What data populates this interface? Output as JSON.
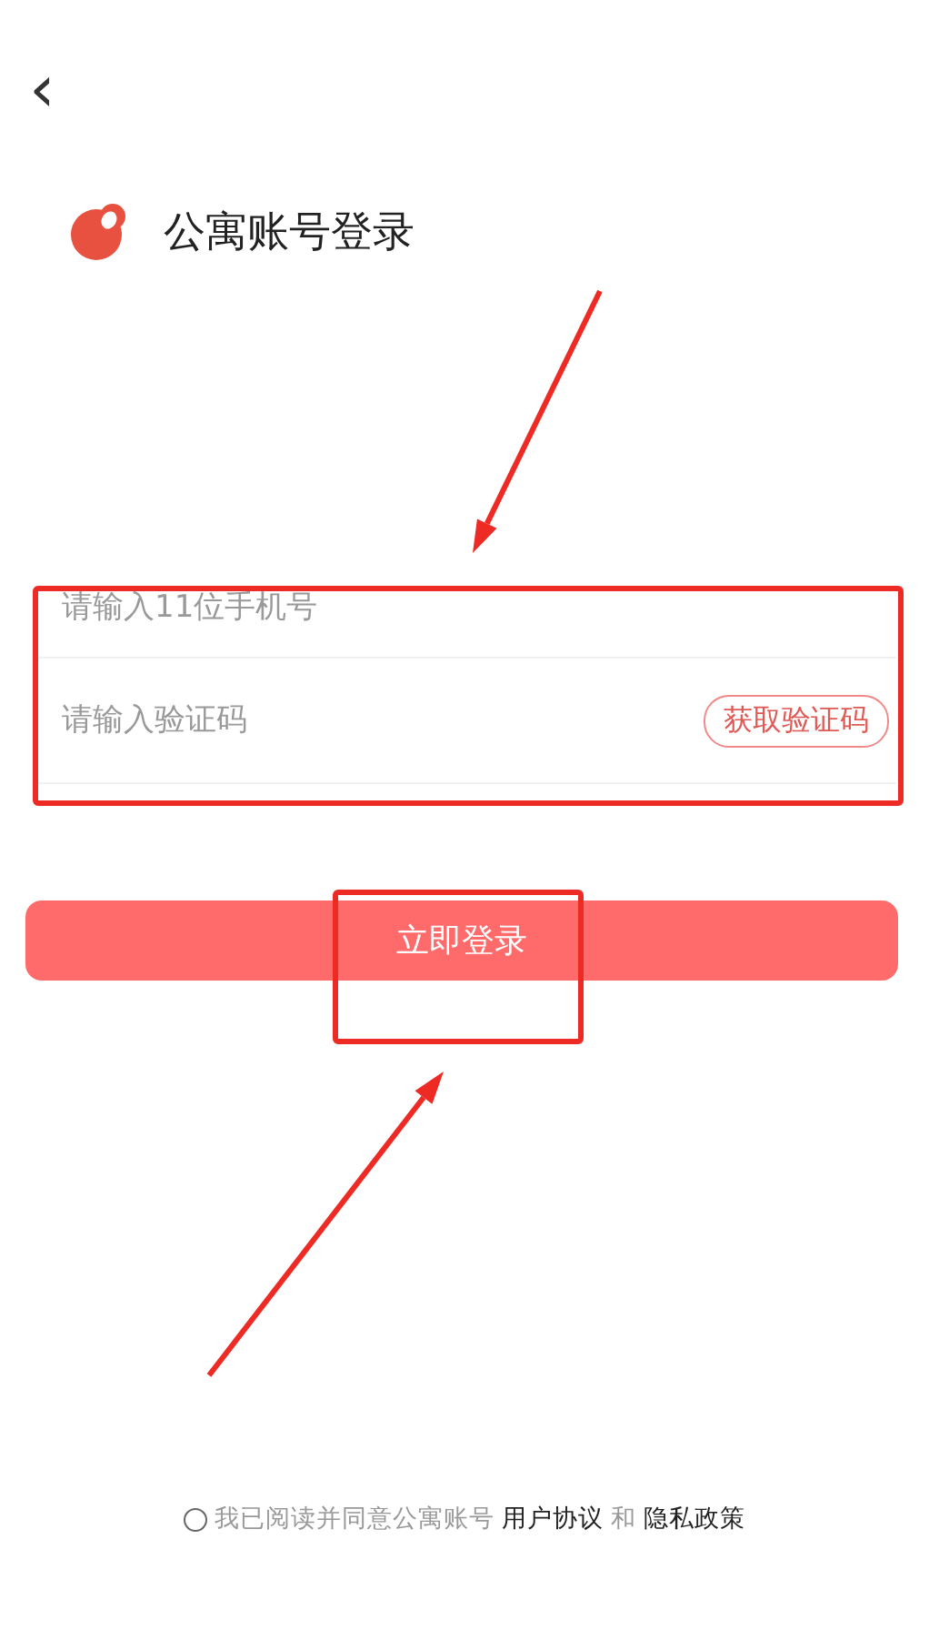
{
  "header": {
    "back": "‹"
  },
  "brand": {
    "title": "公寓账号登录"
  },
  "form": {
    "fields": [
      {
        "placeholder": "请输入11位手机号"
      },
      {
        "placeholder": "请输入验证码",
        "action": "获取验证码"
      }
    ]
  },
  "login_button": "立即登录",
  "agreement": {
    "checked": false,
    "parts": [
      {
        "kind": "text",
        "text": "我已阅读并同意公寓账号"
      },
      {
        "kind": "link",
        "text": "用户协议"
      },
      {
        "kind": "text",
        "text": "和"
      },
      {
        "kind": "link",
        "text": "隐私政策"
      }
    ]
  }
}
